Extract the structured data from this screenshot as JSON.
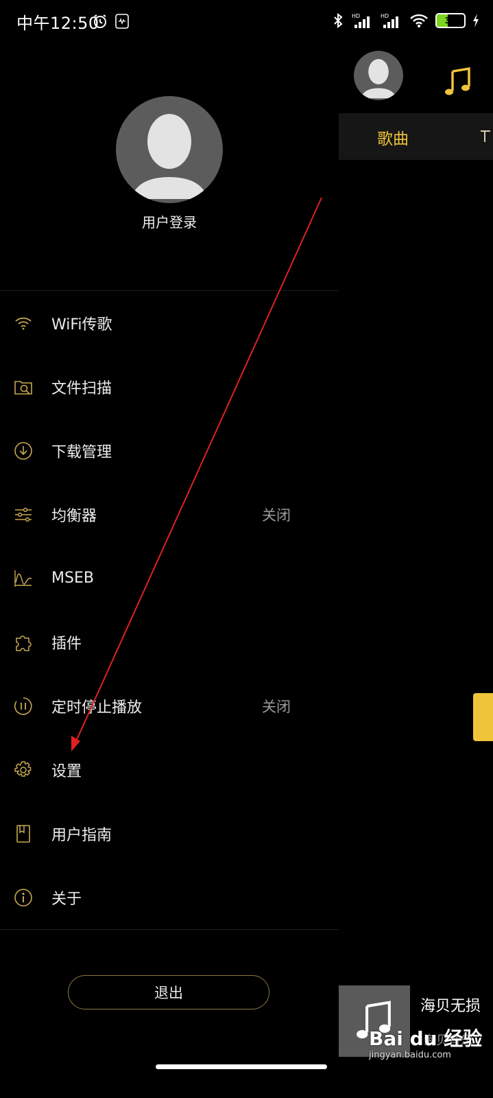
{
  "status_bar": {
    "time": "中午12:50",
    "battery": "39"
  },
  "drawer": {
    "login_label": "用户登录",
    "menu": [
      {
        "icon": "wifi-icon",
        "label": "WiFi传歌",
        "status": ""
      },
      {
        "icon": "folder-scan-icon",
        "label": "文件扫描",
        "status": ""
      },
      {
        "icon": "download-icon",
        "label": "下载管理",
        "status": ""
      },
      {
        "icon": "equalizer-icon",
        "label": "均衡器",
        "status": "关闭"
      },
      {
        "icon": "waveform-icon",
        "label": "MSEB",
        "status": ""
      },
      {
        "icon": "puzzle-icon",
        "label": "插件",
        "status": ""
      },
      {
        "icon": "timer-icon",
        "label": "定时停止播放",
        "status": "关闭"
      },
      {
        "icon": "gear-icon",
        "label": "设置",
        "status": ""
      },
      {
        "icon": "book-icon",
        "label": "用户指南",
        "status": ""
      },
      {
        "icon": "info-icon",
        "label": "关于",
        "status": ""
      }
    ],
    "logout_label": "退出"
  },
  "main": {
    "tab_songs": "歌曲",
    "player": {
      "title": "海贝无损",
      "artist": "海贝音乐"
    }
  },
  "watermark": {
    "brand": "Bai du 经验",
    "url": "jingyan.baidu.com"
  },
  "colors": {
    "accent": "#f0c43a",
    "icon_gold": "#c9a951",
    "annotation_red": "#e02020"
  }
}
